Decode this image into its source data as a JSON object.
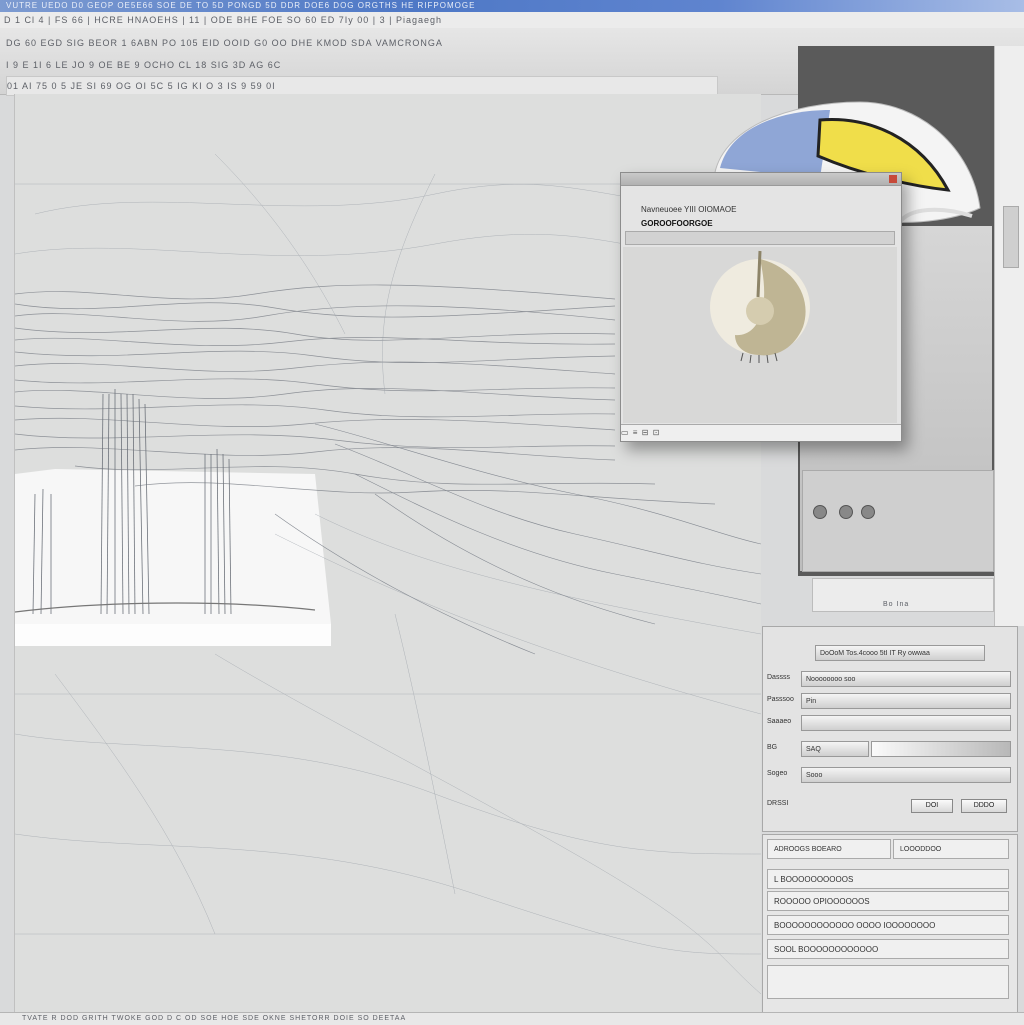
{
  "window": {
    "title_text": "VUTRE UEDO D0 GEOP OE5E66 SOE DE TO 5D PONGD 5D DDR DOE6 DOG ORGTHS HE RIFPOMOGE"
  },
  "menubar": {
    "text": "D 1 Cl 4 | FS 66 | HCRE HNAOEHS | 11 | ODE BHE FOE SO 60 ED 7Iy 00 | 3 | Piagaegh"
  },
  "toolbar": {
    "row1_text": "DG 60 EGD SIG BEOR 1 6ABN PO 105 EID OOID G0 OO DHE KMOD SDA VAMCRONGA",
    "row2_text": "I 9 E 1I 6 LE JO 9 OE BE 9 OCHO CL 18 SIG 3D AG 6C",
    "row3_text": "01 AI 75 0 5 JE SI 69 OG OI 5C 5 IG KI O 3 IS 9 59 0I"
  },
  "preview_window": {
    "label_1": "Navneuoee YIII OIOMAOE",
    "label_2": "GOROOFOORGOE",
    "status_text": "▭ ≡ ⊟ ⊡"
  },
  "props_panel": {
    "header_field": "DoOoM Tos.4cooo 5tI IT Ry owwaa",
    "rows": [
      {
        "label": "Dassss",
        "value": "Noooooooo soo"
      },
      {
        "label": "Passsoo",
        "value": "Pin"
      },
      {
        "label": "Saaaeo",
        "value": ""
      },
      {
        "label": "BG",
        "value": "SAQ"
      },
      {
        "label": "Sogeo",
        "value": "Sooo"
      },
      {
        "label": "DRSSI",
        "value": ""
      }
    ],
    "button_ok": "DOI",
    "button_cancel": "DDDO"
  },
  "props_panel_2": {
    "tab_1": "ADROOGS BOEARO",
    "tab_2": "LOOODDOO",
    "field_1": "L BOOOOOOOOOOS",
    "field_2": "ROOOOO OPIOOOOOOS",
    "field_3": "BOOOOOOOOOOOO OOOO IOOOOOOOO",
    "field_4": "SOOL BOOOOOOOOOOOO"
  },
  "mini_toolbar": {
    "text": "Bo Ina"
  },
  "statusbar": {
    "text": "TVATE R DOD GRITH TWOKE GOD D C OD SOE HOE SDE OKNE SHETORR DOIE SO DEETAA"
  },
  "colors": {
    "title_bar": "#4e78c6",
    "logo_blue": "#8fa6d6",
    "logo_yellow": "#f0de4a",
    "canvas_bg": "#dddedd",
    "dark_panel": "#5a5a5a"
  }
}
